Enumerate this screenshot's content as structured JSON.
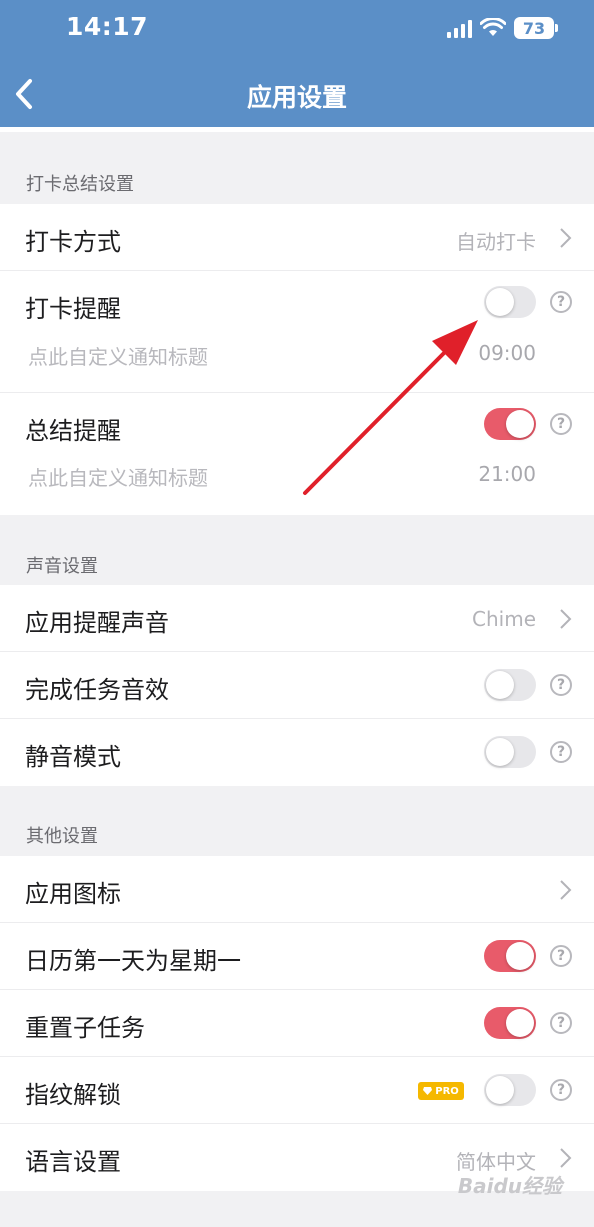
{
  "status_bar": {
    "time": "14:17",
    "battery": "73"
  },
  "nav": {
    "title": "应用设置",
    "back_icon": "chevron-left-icon"
  },
  "sections": {
    "checkin": {
      "title": "打卡总结设置",
      "checkin_method": {
        "label": "打卡方式",
        "value": "自动打卡"
      },
      "checkin_reminder": {
        "label": "打卡提醒",
        "enabled": false,
        "sub_label": "点此自定义通知标题",
        "time": "09:00"
      },
      "summary_reminder": {
        "label": "总结提醒",
        "enabled": true,
        "sub_label": "点此自定义通知标题",
        "time": "21:00"
      }
    },
    "sound": {
      "title": "声音设置",
      "reminder_sound": {
        "label": "应用提醒声音",
        "value": "Chime"
      },
      "task_sound": {
        "label": "完成任务音效",
        "enabled": false
      },
      "mute_mode": {
        "label": "静音模式",
        "enabled": false
      }
    },
    "other": {
      "title": "其他设置",
      "app_icon": {
        "label": "应用图标"
      },
      "monday_first": {
        "label": "日历第一天为星期一",
        "enabled": true
      },
      "reset_subtasks": {
        "label": "重置子任务",
        "enabled": true
      },
      "fingerprint": {
        "label": "指纹解锁",
        "badge": "PRO",
        "enabled": false
      },
      "language": {
        "label": "语言设置",
        "value": "简体中文"
      }
    }
  },
  "help_glyph": "?",
  "watermark": "Baidu经验",
  "colors": {
    "header": "#5b8fc7",
    "toggle_on": "#e85b6a",
    "toggle_off": "#e7e7ea",
    "pro_badge": "#f5b800",
    "annotation_arrow": "#e0202a"
  }
}
